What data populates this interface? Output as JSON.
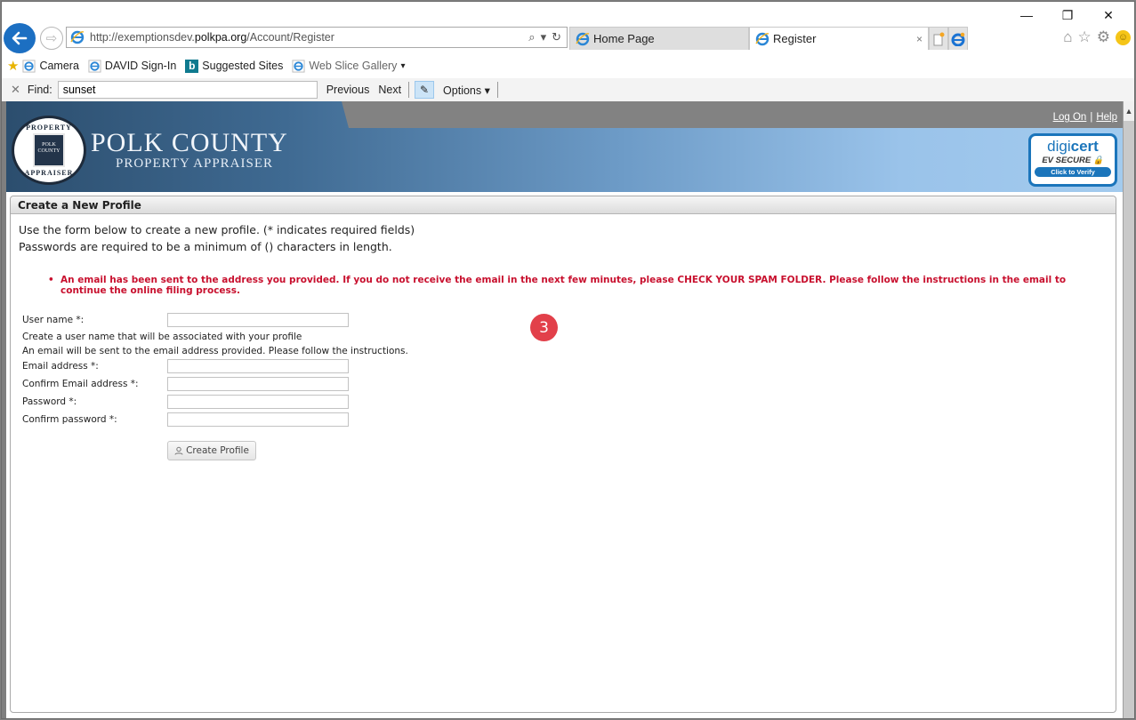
{
  "browser": {
    "window_controls": {
      "minimize": "—",
      "restore": "❐",
      "close": "✕"
    },
    "address_bar": {
      "url_prefix": "http://exemptionsdev.",
      "url_domain": "polkpa.org",
      "url_suffix": "/Account/Register",
      "search_icon": "⌕",
      "dropdown_icon": "▾",
      "refresh_icon": "↻"
    },
    "tabs": [
      {
        "label": "Home Page",
        "active": false
      },
      {
        "label": "Register",
        "active": true
      }
    ],
    "tab_close": "×",
    "favorites": [
      {
        "label": "Camera",
        "icon": "ie-icon"
      },
      {
        "label": "DAVID Sign-In",
        "icon": "ie-icon"
      },
      {
        "label": "Suggested Sites",
        "icon": "bing-icon"
      },
      {
        "label": "Web Slice Gallery",
        "icon": "ie-icon",
        "dropdown": "▾"
      }
    ],
    "find_bar": {
      "close": "✕",
      "label": "Find:",
      "value": "sunset",
      "previous": "Previous",
      "next": "Next",
      "options": "Options ▾"
    }
  },
  "site": {
    "brand_line1": "POLK COUNTY",
    "brand_line2": "PROPERTY APPRAISER",
    "seal_top": "PROPERTY",
    "seal_bottom": "APPRAISER",
    "seal_inner1": "POLK",
    "seal_inner2": "COUNTY",
    "links": {
      "log_on": "Log On",
      "separator": "|",
      "help": "Help"
    },
    "digicert": {
      "brand_a": "digi",
      "brand_b": "cert",
      "ev": "EV SECURE 🔒",
      "verify": "Click to Verify"
    }
  },
  "panel": {
    "title": "Create a New Profile",
    "intro1": "Use the form below to create a new profile. (* indicates required fields)",
    "intro2": "Passwords are required to be a minimum of () characters in length.",
    "alert": "An email has been sent to the address you provided. If you do not receive the email in the next few minutes, please CHECK YOUR SPAM FOLDER. Please follow the instructions in the email to continue the online filing process."
  },
  "form": {
    "username_label": "User name *:",
    "username_value": "",
    "username_help": "Create a user name that will be associated with your profile",
    "email_help": "An email will be sent to the email address provided. Please follow the instructions.",
    "email_label": "Email address *:",
    "email_value": "",
    "confirm_email_label": "Confirm Email address *:",
    "confirm_email_value": "",
    "password_label": "Password *:",
    "confirm_password_label": "Confirm password *:",
    "submit_label": "Create Profile"
  },
  "annotation": {
    "step": "3"
  }
}
